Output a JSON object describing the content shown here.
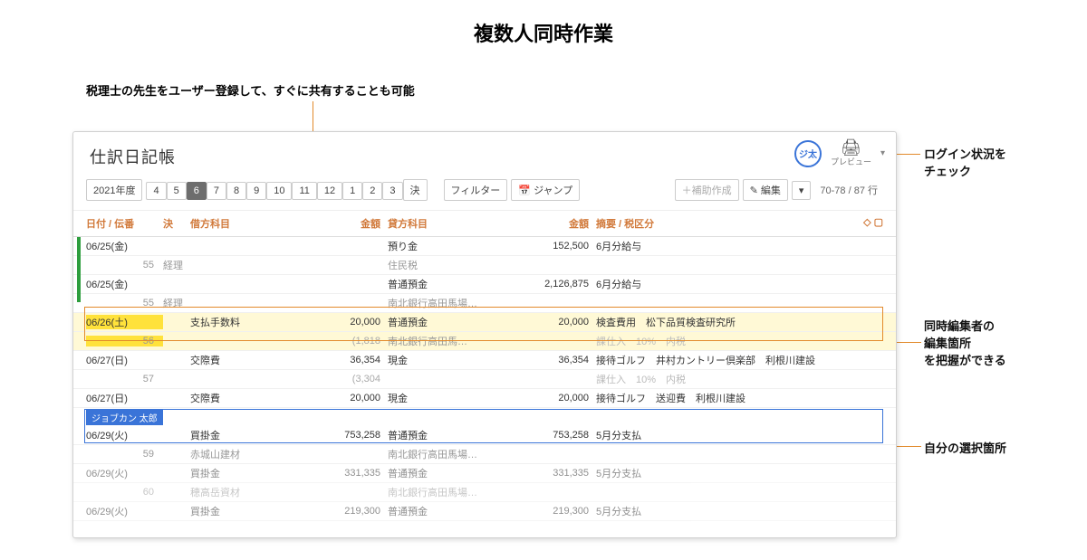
{
  "page_heading": "複数人同時作業",
  "top_caption": "税理士の先生をユーザー登録して、すぐに共有することも可能",
  "callouts": {
    "login_check": "ログイン状況を\nチェック",
    "other_editor": "同時編集者の\n編集箇所\nを把握ができる",
    "self_select": "自分の選択箇所"
  },
  "window": {
    "title": "仕訳日記帳",
    "avatar_label": "ジ太",
    "print_label": "プレビュー",
    "year_label": "2021年度",
    "months": [
      "4",
      "5",
      "6",
      "7",
      "8",
      "9",
      "10",
      "11",
      "12",
      "1",
      "2",
      "3"
    ],
    "settle_btn_left": "決",
    "settle_btn_right": "決",
    "active_month": "6",
    "filter_btn": "フィルター",
    "jump_btn": "ジャンプ",
    "aux_btn": "＋補助作成",
    "edit_btn": "編集",
    "range": "70-78 / 87 行",
    "headers": {
      "date": "日付 / 伝番",
      "settle": "決",
      "debit": "借方科目",
      "amt1": "金額",
      "credit": "貸方科目",
      "amt2": "金額",
      "desc": "摘要 / 税区分"
    },
    "rows": [
      {
        "type": "main",
        "date": "06/25(金)",
        "debit": "",
        "amt1": "",
        "credit": "預り金",
        "amt2": "152,500",
        "desc": "6月分給与"
      },
      {
        "type": "sub",
        "date": "55",
        "note": "経理",
        "credit": "住民税"
      },
      {
        "type": "main",
        "date": "06/25(金)",
        "credit": "普通預金",
        "amt2": "2,126,875",
        "desc": "6月分給与"
      },
      {
        "type": "sub",
        "date": "55",
        "note": "経理",
        "credit": "南北銀行高田馬場…"
      },
      {
        "type": "main",
        "hl": "yellow",
        "date": "06/26(土)",
        "debit": "支払手数料",
        "amt1": "20,000",
        "credit": "普通預金",
        "amt2": "20,000",
        "desc": "検査費用　松下品質検査研究所"
      },
      {
        "type": "sub",
        "hl": "yellow",
        "date": "56",
        "amt1": "(1,818",
        "credit": "南北銀行高田馬…",
        "desc_gray": "課仕入　10%　内税"
      },
      {
        "type": "main",
        "date": "06/27(日)",
        "debit": "交際費",
        "amt1": "36,354",
        "credit": "現金",
        "amt2": "36,354",
        "desc": "接待ゴルフ　井村カントリー倶楽部　利根川建設"
      },
      {
        "type": "sub",
        "date": "57",
        "amt1": "(3,304",
        "desc_gray": "課仕入　10%　内税"
      },
      {
        "type": "main",
        "date": "06/27(日)",
        "debit": "交際費",
        "amt1": "20,000",
        "credit": "現金",
        "amt2": "20,000",
        "desc": "接待ゴルフ　送迎費　利根川建設"
      },
      {
        "type": "usertag",
        "label": "ジョブカン 太郎"
      },
      {
        "type": "main",
        "self": true,
        "date": "06/29(火)",
        "debit": "買掛金",
        "amt1": "753,258",
        "credit": "普通預金",
        "amt2": "753,258",
        "desc": "5月分支払"
      },
      {
        "type": "sub",
        "self": true,
        "date": "59",
        "debit": "赤城山建材",
        "credit": "南北銀行高田馬場…"
      },
      {
        "type": "main",
        "dim": true,
        "date": "06/29(火)",
        "debit": "買掛金",
        "amt1": "331,335",
        "credit": "普通預金",
        "amt2": "331,335",
        "desc": "5月分支払"
      },
      {
        "type": "sub",
        "dim": true,
        "date": "60",
        "debit": "穂高岳資材",
        "credit": "南北銀行高田馬場…"
      },
      {
        "type": "main",
        "dim": true,
        "date": "06/29(火)",
        "debit": "買掛金",
        "amt1": "219,300",
        "credit": "普通預金",
        "amt2": "219,300",
        "desc": "5月分支払"
      }
    ]
  }
}
